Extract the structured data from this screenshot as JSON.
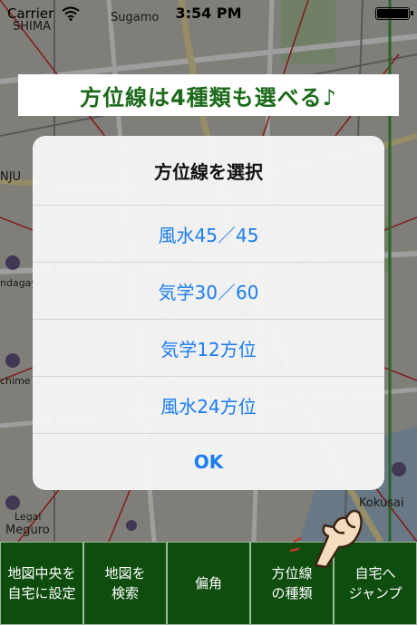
{
  "status_bar": {
    "carrier": "Carrier",
    "time": "3:54 PM"
  },
  "map": {
    "labels": {
      "sugamo": "Sugamo",
      "shima": "SHIMA",
      "nju": "NJU",
      "ndagaya": "ndagaya",
      "chime": "chime",
      "legal": "Legal",
      "meguro": "Meguro",
      "kokusai": "Kokusai"
    }
  },
  "banner": {
    "text": "方位線は4種類も選べる♪"
  },
  "dialog": {
    "title": "方位線を選択",
    "options": [
      "風水45／45",
      "気学30／60",
      "気学12方位",
      "風水24方位"
    ],
    "ok_label": "OK"
  },
  "toolbar": {
    "buttons": [
      "地図中央を\n自宅に設定",
      "地図を\n検索",
      "偏角",
      "方位線\nの種類",
      "自宅へ\nジャンプ"
    ]
  },
  "colors": {
    "toolbar_bg": "#0f4d0f",
    "banner_text": "#1c6a1a",
    "ios_blue": "#1a7cf0"
  }
}
